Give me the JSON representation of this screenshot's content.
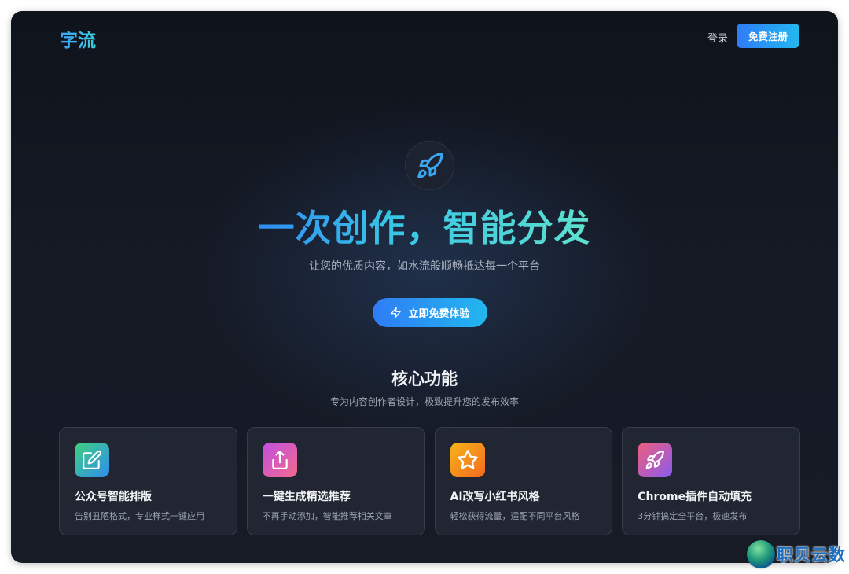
{
  "header": {
    "logo": "字流",
    "login_label": "登录",
    "register_label": "免费注册"
  },
  "hero": {
    "icon": "rocket-icon",
    "title": "一次创作，智能分发",
    "subtitle": "让您的优质内容，如水流般顺畅抵达每一个平台",
    "cta_label": "立即免费体验",
    "cta_icon": "lightning-icon"
  },
  "features": {
    "title": "核心功能",
    "subtitle": "专为内容创作者设计，极致提升您的发布效率",
    "items": [
      {
        "icon": "edit-icon",
        "title": "公众号智能排版",
        "desc": "告别丑陋格式，专业样式一键应用",
        "color_from": "#3fcf7f",
        "color_to": "#2f8ef0"
      },
      {
        "icon": "share-icon",
        "title": "一键生成精选推荐",
        "desc": "不再手动添加，智能推荐相关文章",
        "color_from": "#c04fe0",
        "color_to": "#f26a8d"
      },
      {
        "icon": "star-icon",
        "title": "AI改写小红书风格",
        "desc": "轻松获得流量，适配不同平台风格",
        "color_from": "#f7b418",
        "color_to": "#f46a1f"
      },
      {
        "icon": "rocket-icon",
        "title": "Chrome插件自动填充",
        "desc": "3分钟搞定全平台，极速发布",
        "color_from": "#ef5d7a",
        "color_to": "#8a5cf0"
      }
    ]
  },
  "watermark": {
    "text": "职贝云数"
  },
  "colors": {
    "accent_start": "#2f7cf6",
    "accent_end": "#23b8f0",
    "background": "#151a25"
  }
}
